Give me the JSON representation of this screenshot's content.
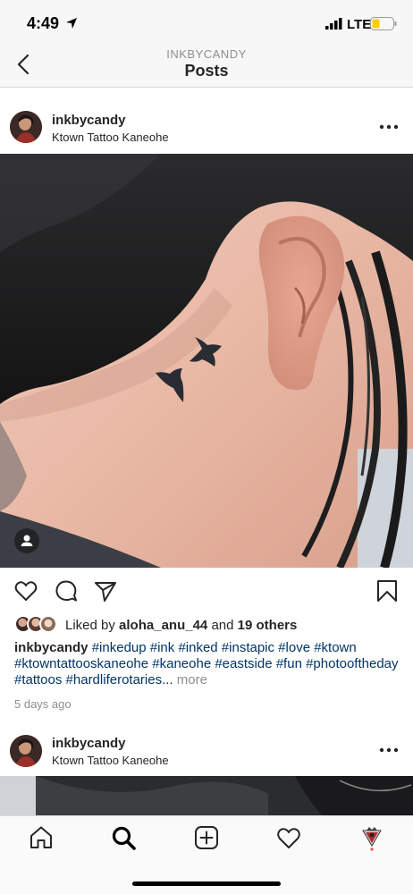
{
  "status_bar": {
    "time": "4:49",
    "network": "LTE"
  },
  "nav": {
    "username": "INKBYCANDY",
    "title": "Posts"
  },
  "post": {
    "username": "inkbycandy",
    "location": "Ktown Tattoo Kaneohe",
    "likes_prefix": "Liked by",
    "liked_by_user": "aloha_anu_44",
    "likes_and": "and",
    "likes_others": "19 others",
    "caption_user": "inkbycandy",
    "caption_tags": "#inkedup #ink #inked #instapic #love #ktown #ktowntattooskaneohe #kaneohe #eastside #fun #photooftheday #tattoos #hardliferotaries...",
    "caption_more": "more",
    "date": "5 days ago"
  },
  "next_post": {
    "username": "inkbycandy",
    "location": "Ktown Tattoo Kaneohe"
  },
  "icons": {
    "back": "chevron-left-icon",
    "more": "ellipsis-icon",
    "like": "heart-icon",
    "comment": "comment-icon",
    "share": "paper-plane-icon",
    "save": "bookmark-icon",
    "tab_home": "home-icon",
    "tab_search": "search-icon",
    "tab_new": "plus-square-icon",
    "tab_activity": "heart-icon",
    "tab_profile": "profile-avatar-icon"
  },
  "colors": {
    "text": "#262626",
    "secondary": "#8e8e8e",
    "hashtag": "#003569",
    "battery": "#ffcc00"
  }
}
